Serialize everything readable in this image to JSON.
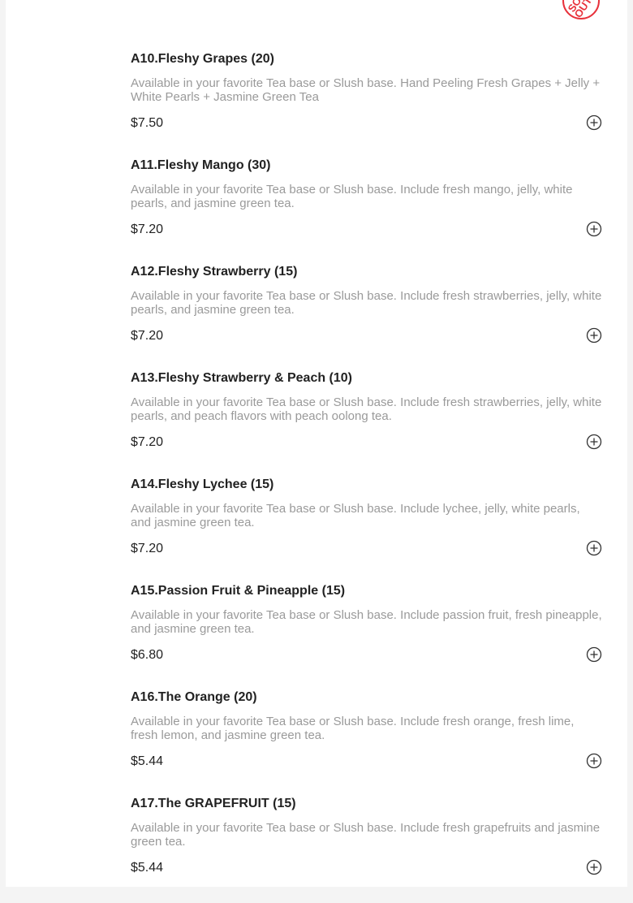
{
  "badge": {
    "text_line1": "SOLD",
    "text_line2": "OUT",
    "color": "#e8323c"
  },
  "items": [
    {
      "title": "A10.Fleshy Grapes (20)",
      "description": "Available in your favorite Tea base or Slush base. Hand Peeling Fresh Grapes + Jelly + White Pearls + Jasmine Green Tea",
      "price": "$7.50",
      "add_icon": "plus-circle-icon"
    },
    {
      "title": "A11.Fleshy Mango (30)",
      "description": "Available in your favorite Tea base or Slush base. Include fresh mango, jelly, white pearls, and jasmine green tea.",
      "price": "$7.20",
      "add_icon": "plus-circle-icon"
    },
    {
      "title": "A12.Fleshy Strawberry (15)",
      "description": "Available in your favorite Tea base or Slush base. Include fresh strawberries, jelly, white pearls, and jasmine green tea.",
      "price": "$7.20",
      "add_icon": "plus-circle-icon"
    },
    {
      "title": "A13.Fleshy Strawberry & Peach (10)",
      "description": "Available in your favorite Tea base or Slush base. Include fresh strawberries, jelly, white pearls, and peach flavors with peach oolong tea.",
      "price": "$7.20",
      "add_icon": "plus-circle-icon"
    },
    {
      "title": "A14.Fleshy Lychee (15)",
      "description": "Available in your favorite Tea base or Slush base. Include lychee, jelly, white pearls, and jasmine green tea.",
      "price": "$7.20",
      "add_icon": "plus-circle-icon"
    },
    {
      "title": "A15.Passion Fruit & Pineapple (15)",
      "description": "Available in your favorite Tea base or Slush base. Include passion fruit, fresh pineapple, and jasmine green tea.",
      "price": "$6.80",
      "add_icon": "plus-circle-icon"
    },
    {
      "title": "A16.The Orange (20)",
      "description": "Available in your favorite Tea base or Slush base. Include fresh orange, fresh lime, fresh lemon, and jasmine green tea.",
      "price": "$5.44",
      "add_icon": "plus-circle-icon"
    },
    {
      "title": "A17.The GRAPEFRUIT (15)",
      "description": "Available in your favorite Tea base or Slush base. Include fresh grapefruits and jasmine green tea.",
      "price": "$5.44",
      "add_icon": "plus-circle-icon"
    }
  ]
}
